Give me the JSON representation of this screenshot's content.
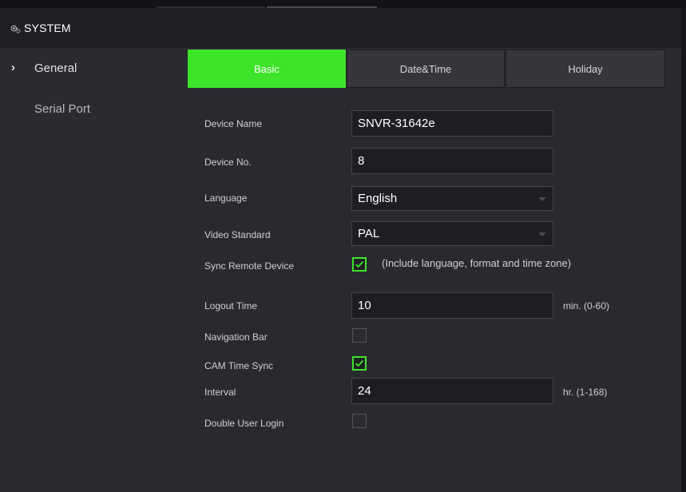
{
  "header": {
    "title": "SYSTEM",
    "icon": "gear-icon"
  },
  "sidebar": {
    "items": [
      {
        "label": "General",
        "selected": true
      },
      {
        "label": "Serial Port",
        "selected": false
      }
    ]
  },
  "tabs": [
    {
      "label": "Basic",
      "active": true
    },
    {
      "label": "Date&Time",
      "active": false
    },
    {
      "label": "Holiday",
      "active": false
    }
  ],
  "form": {
    "device_name": {
      "label": "Device Name",
      "value": "SNVR-31642e"
    },
    "device_no": {
      "label": "Device No.",
      "value": "8"
    },
    "language": {
      "label": "Language",
      "value": "English"
    },
    "video_standard": {
      "label": "Video Standard",
      "value": "PAL"
    },
    "sync_remote_device": {
      "label": "Sync Remote Device",
      "checked": true,
      "note": "(Include language, format and time zone)"
    },
    "logout_time": {
      "label": "Logout Time",
      "value": "10",
      "unit": "min. (0-60)"
    },
    "navigation_bar": {
      "label": "Navigation Bar",
      "checked": false
    },
    "cam_time_sync": {
      "label": "CAM Time Sync",
      "checked": true
    },
    "interval": {
      "label": "Interval",
      "value": "24",
      "unit": "hr. (1-168)"
    },
    "double_user_login": {
      "label": "Double User Login",
      "checked": false
    }
  },
  "colors": {
    "accent": "#3ee42a",
    "background": "#292a30",
    "sidebar": "#2a2b30",
    "header": "#1f2024"
  }
}
